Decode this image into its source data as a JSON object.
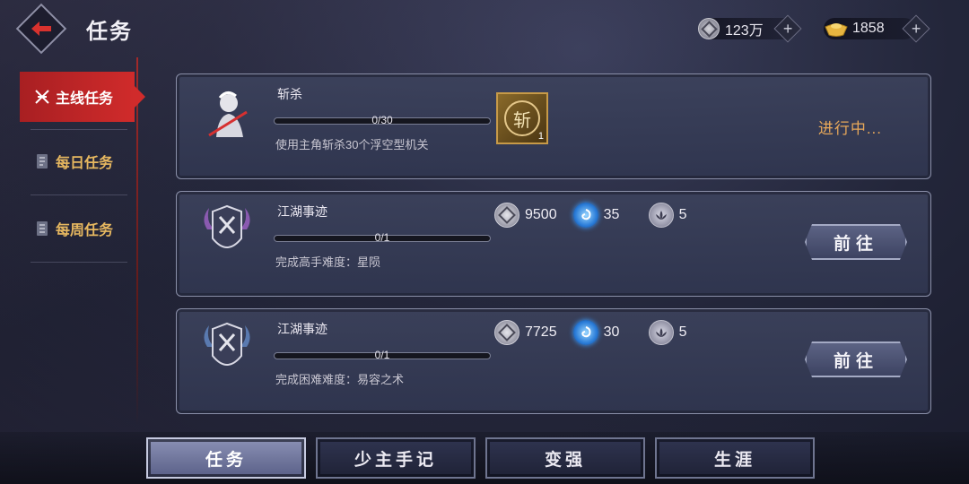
{
  "header": {
    "title": "任务",
    "currencies": [
      {
        "icon": "silver-coin-icon",
        "amount": "123万"
      },
      {
        "icon": "gold-ingot-icon",
        "amount": "1858"
      }
    ]
  },
  "sidebar": {
    "items": [
      {
        "label": "主线任务",
        "icon": "main-quest-icon",
        "active": true
      },
      {
        "label": "每日任务",
        "icon": "scroll-icon",
        "active": false
      },
      {
        "label": "每周任务",
        "icon": "book-icon",
        "active": false
      }
    ]
  },
  "tasks": [
    {
      "name": "斩杀",
      "progress_text": "0/30",
      "progress": 0,
      "description": "使用主角斩杀30个浮空型机关",
      "reward_item": {
        "char": "斩",
        "qty": "1"
      },
      "status": "进行中..."
    },
    {
      "name": "江湖事迹",
      "progress_text": "0/1",
      "progress": 0,
      "description": "完成高手难度：星陨",
      "rewards": [
        {
          "icon": "silver-coin-icon",
          "amount": "9500"
        },
        {
          "icon": "blue-swirl-icon",
          "amount": "35"
        },
        {
          "icon": "lotus-icon",
          "amount": "5"
        }
      ],
      "button": "前往"
    },
    {
      "name": "江湖事迹",
      "progress_text": "0/1",
      "progress": 0,
      "description": "完成困难难度：易容之术",
      "rewards": [
        {
          "icon": "silver-coin-icon",
          "amount": "7725"
        },
        {
          "icon": "blue-swirl-icon",
          "amount": "30"
        },
        {
          "icon": "lotus-icon",
          "amount": "5"
        }
      ],
      "button": "前往"
    }
  ],
  "bottom_tabs": [
    {
      "label": "任务",
      "active": true
    },
    {
      "label": "少主手记",
      "active": false
    },
    {
      "label": "变强",
      "active": false
    },
    {
      "label": "生涯",
      "active": false
    }
  ],
  "colors": {
    "accent_red": "#c8262a",
    "sidebar_inactive_text": "#e7b860",
    "status_orange": "#e8a85a"
  }
}
